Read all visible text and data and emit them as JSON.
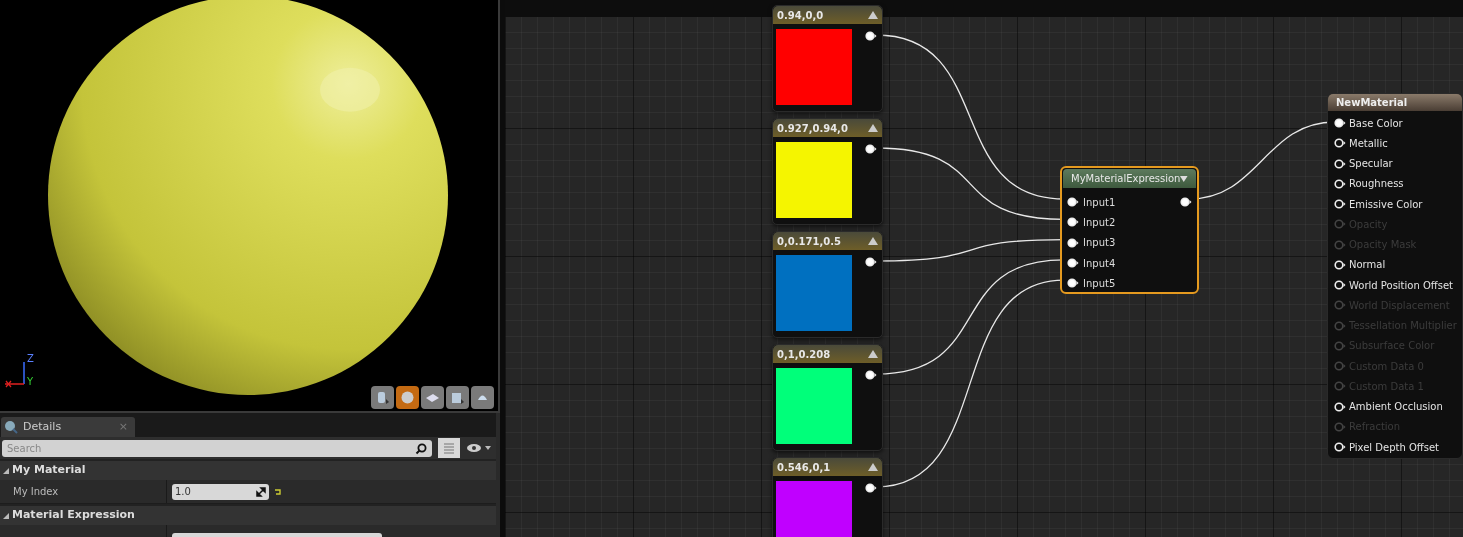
{
  "viewport": {
    "axes": [
      "Z",
      "Y"
    ],
    "view_buttons": [
      {
        "selected": false
      },
      {
        "selected": true
      },
      {
        "selected": false
      },
      {
        "selected": false
      },
      {
        "selected": false
      }
    ]
  },
  "details": {
    "tab": {
      "label": "Details",
      "close": "×"
    },
    "search": {
      "placeholder": "Search"
    },
    "categories": [
      {
        "title": "My Material",
        "properties": [
          {
            "kind": "number",
            "label": "My Index",
            "value": "1.0"
          }
        ]
      },
      {
        "title": "Material Expression",
        "properties": [
          {
            "kind": "text"
          }
        ]
      }
    ]
  },
  "graph": {
    "constants": [
      {
        "label": "0.94,0,0",
        "color": "#ff0000"
      },
      {
        "label": "0.927,0.94,0",
        "color": "#f5f500"
      },
      {
        "label": "0,0.171,0.5",
        "color": "#0070c0"
      },
      {
        "label": "0,1,0.208",
        "color": "#00ff7a"
      },
      {
        "label": "0.546,0,1",
        "color": "#c000ff"
      }
    ],
    "expression": {
      "title": "MyMaterialExpression",
      "selected": true,
      "inputs": [
        "Input1",
        "Input2",
        "Input3",
        "Input4",
        "Input5"
      ]
    },
    "material": {
      "title": "NewMaterial",
      "inputs": [
        {
          "label": "Base Color",
          "enabled": true,
          "connected": true
        },
        {
          "label": "Metallic",
          "enabled": true,
          "connected": false
        },
        {
          "label": "Specular",
          "enabled": true,
          "connected": false
        },
        {
          "label": "Roughness",
          "enabled": true,
          "connected": false
        },
        {
          "label": "Emissive Color",
          "enabled": true,
          "connected": false
        },
        {
          "label": "Opacity",
          "enabled": false,
          "connected": false
        },
        {
          "label": "Opacity Mask",
          "enabled": false,
          "connected": false
        },
        {
          "label": "Normal",
          "enabled": true,
          "connected": false
        },
        {
          "label": "World Position Offset",
          "enabled": true,
          "connected": false
        },
        {
          "label": "World Displacement",
          "enabled": false,
          "connected": false
        },
        {
          "label": "Tessellation Multiplier",
          "enabled": false,
          "connected": false
        },
        {
          "label": "Subsurface Color",
          "enabled": false,
          "connected": false
        },
        {
          "label": "Custom Data 0",
          "enabled": false,
          "connected": false
        },
        {
          "label": "Custom Data 1",
          "enabled": false,
          "connected": false
        },
        {
          "label": "Ambient Occlusion",
          "enabled": true,
          "connected": false
        },
        {
          "label": "Refraction",
          "enabled": false,
          "connected": false
        },
        {
          "label": "Pixel Depth Offset",
          "enabled": true,
          "connected": false
        }
      ]
    }
  }
}
